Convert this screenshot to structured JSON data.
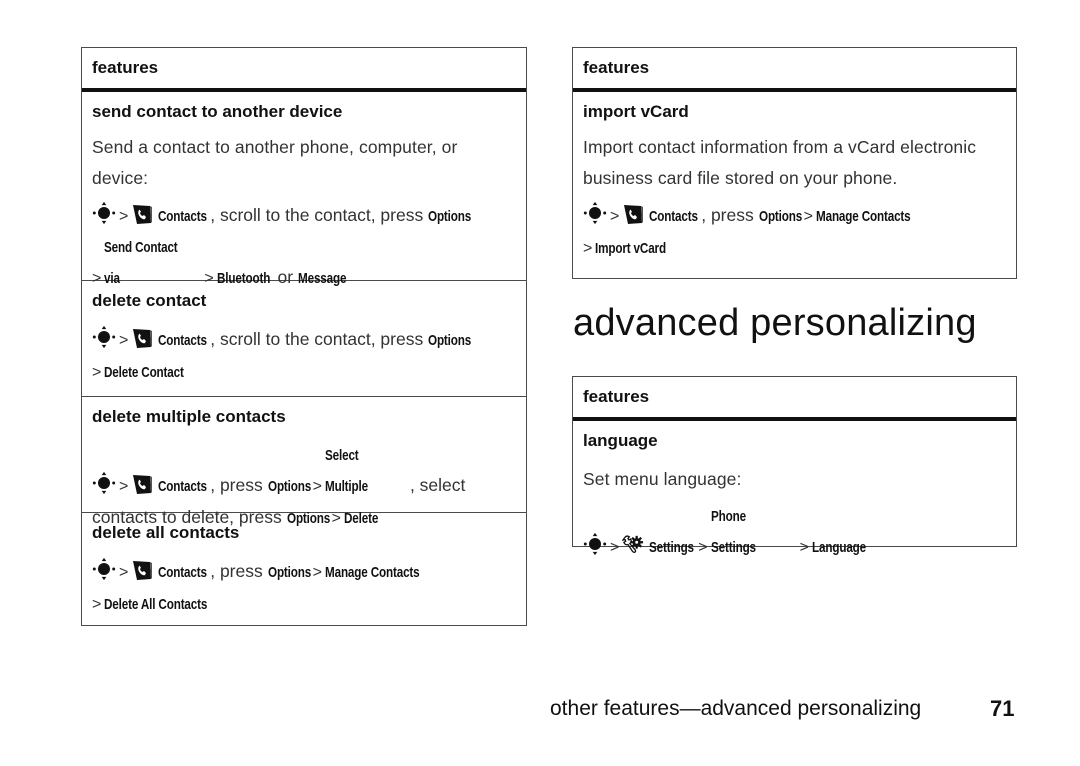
{
  "page": {
    "section_heading": "advanced personalizing",
    "footer": "other features—advanced personalizing",
    "page_number": "71"
  },
  "icons": {
    "nav_key": "nav-key-icon",
    "contacts": "contacts-icon",
    "settings": "settings-icon",
    "separator": ">"
  },
  "left_table": {
    "header": "features",
    "rows": [
      {
        "title": "send contact to another device",
        "description": "Send a contact to another phone, computer, or device:",
        "path": {
          "contacts": "Contacts",
          "text1": ", scroll to the contact, press ",
          "options": "Options",
          "line2_a": "Send Contact via",
          "line2_b": "Bluetooth",
          "or": " or ",
          "line2_c": "Message"
        }
      },
      {
        "title": "delete contact",
        "path": {
          "contacts": "Contacts",
          "text1": ", scroll to the contact, press ",
          "options": "Options",
          "line2_a": "Delete Contact"
        }
      },
      {
        "title": "delete multiple contacts",
        "path": {
          "contacts": "Contacts",
          "text1": ", press ",
          "options": "Options",
          "select_multiple": "Select Multiple",
          "text2": ", select",
          "text3": "contacts to delete, press ",
          "options2": "Options",
          "delete": "Delete"
        }
      },
      {
        "title": "delete all contacts",
        "path": {
          "contacts": "Contacts",
          "text1": ", press ",
          "options": "Options",
          "manage": "Manage Contacts",
          "line2_a": "Delete All Contacts"
        }
      }
    ]
  },
  "right_table_1": {
    "header": "features",
    "rows": [
      {
        "title": "import vCard",
        "description": "Import contact information from a vCard electronic business card file stored on your phone.",
        "path": {
          "contacts": "Contacts",
          "text1": ", press ",
          "options": "Options",
          "manage": "Manage Contacts",
          "line2_a": "Import vCard"
        }
      }
    ]
  },
  "right_table_2": {
    "header": "features",
    "rows": [
      {
        "title": "language",
        "description": "Set menu language:",
        "path": {
          "settings": "Settings",
          "phone_settings": "Phone Settings",
          "language": "Language"
        }
      }
    ]
  }
}
